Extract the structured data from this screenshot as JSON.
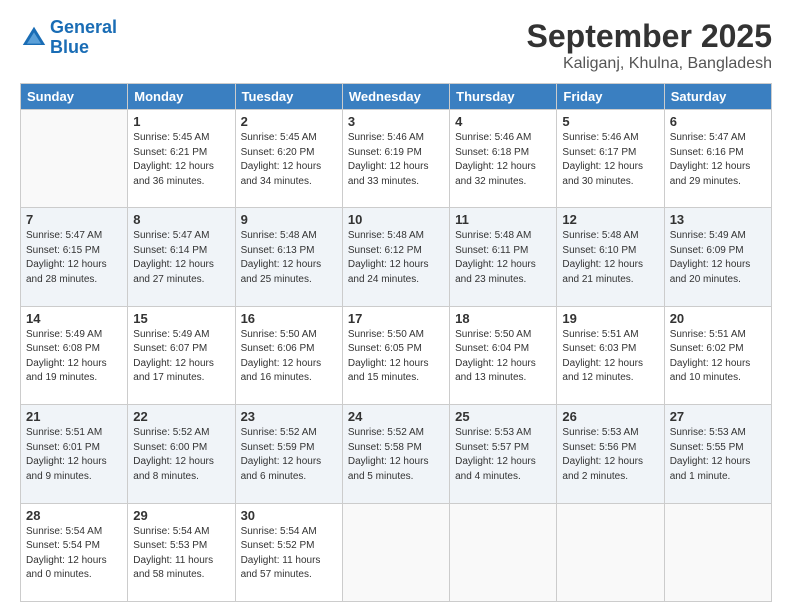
{
  "logo": {
    "line1": "General",
    "line2": "Blue"
  },
  "title": "September 2025",
  "subtitle": "Kaliganj, Khulna, Bangladesh",
  "headers": [
    "Sunday",
    "Monday",
    "Tuesday",
    "Wednesday",
    "Thursday",
    "Friday",
    "Saturday"
  ],
  "weeks": [
    {
      "days": [
        {
          "num": "",
          "info": ""
        },
        {
          "num": "1",
          "info": "Sunrise: 5:45 AM\nSunset: 6:21 PM\nDaylight: 12 hours\nand 36 minutes."
        },
        {
          "num": "2",
          "info": "Sunrise: 5:45 AM\nSunset: 6:20 PM\nDaylight: 12 hours\nand 34 minutes."
        },
        {
          "num": "3",
          "info": "Sunrise: 5:46 AM\nSunset: 6:19 PM\nDaylight: 12 hours\nand 33 minutes."
        },
        {
          "num": "4",
          "info": "Sunrise: 5:46 AM\nSunset: 6:18 PM\nDaylight: 12 hours\nand 32 minutes."
        },
        {
          "num": "5",
          "info": "Sunrise: 5:46 AM\nSunset: 6:17 PM\nDaylight: 12 hours\nand 30 minutes."
        },
        {
          "num": "6",
          "info": "Sunrise: 5:47 AM\nSunset: 6:16 PM\nDaylight: 12 hours\nand 29 minutes."
        }
      ]
    },
    {
      "days": [
        {
          "num": "7",
          "info": "Sunrise: 5:47 AM\nSunset: 6:15 PM\nDaylight: 12 hours\nand 28 minutes."
        },
        {
          "num": "8",
          "info": "Sunrise: 5:47 AM\nSunset: 6:14 PM\nDaylight: 12 hours\nand 27 minutes."
        },
        {
          "num": "9",
          "info": "Sunrise: 5:48 AM\nSunset: 6:13 PM\nDaylight: 12 hours\nand 25 minutes."
        },
        {
          "num": "10",
          "info": "Sunrise: 5:48 AM\nSunset: 6:12 PM\nDaylight: 12 hours\nand 24 minutes."
        },
        {
          "num": "11",
          "info": "Sunrise: 5:48 AM\nSunset: 6:11 PM\nDaylight: 12 hours\nand 23 minutes."
        },
        {
          "num": "12",
          "info": "Sunrise: 5:48 AM\nSunset: 6:10 PM\nDaylight: 12 hours\nand 21 minutes."
        },
        {
          "num": "13",
          "info": "Sunrise: 5:49 AM\nSunset: 6:09 PM\nDaylight: 12 hours\nand 20 minutes."
        }
      ]
    },
    {
      "days": [
        {
          "num": "14",
          "info": "Sunrise: 5:49 AM\nSunset: 6:08 PM\nDaylight: 12 hours\nand 19 minutes."
        },
        {
          "num": "15",
          "info": "Sunrise: 5:49 AM\nSunset: 6:07 PM\nDaylight: 12 hours\nand 17 minutes."
        },
        {
          "num": "16",
          "info": "Sunrise: 5:50 AM\nSunset: 6:06 PM\nDaylight: 12 hours\nand 16 minutes."
        },
        {
          "num": "17",
          "info": "Sunrise: 5:50 AM\nSunset: 6:05 PM\nDaylight: 12 hours\nand 15 minutes."
        },
        {
          "num": "18",
          "info": "Sunrise: 5:50 AM\nSunset: 6:04 PM\nDaylight: 12 hours\nand 13 minutes."
        },
        {
          "num": "19",
          "info": "Sunrise: 5:51 AM\nSunset: 6:03 PM\nDaylight: 12 hours\nand 12 minutes."
        },
        {
          "num": "20",
          "info": "Sunrise: 5:51 AM\nSunset: 6:02 PM\nDaylight: 12 hours\nand 10 minutes."
        }
      ]
    },
    {
      "days": [
        {
          "num": "21",
          "info": "Sunrise: 5:51 AM\nSunset: 6:01 PM\nDaylight: 12 hours\nand 9 minutes."
        },
        {
          "num": "22",
          "info": "Sunrise: 5:52 AM\nSunset: 6:00 PM\nDaylight: 12 hours\nand 8 minutes."
        },
        {
          "num": "23",
          "info": "Sunrise: 5:52 AM\nSunset: 5:59 PM\nDaylight: 12 hours\nand 6 minutes."
        },
        {
          "num": "24",
          "info": "Sunrise: 5:52 AM\nSunset: 5:58 PM\nDaylight: 12 hours\nand 5 minutes."
        },
        {
          "num": "25",
          "info": "Sunrise: 5:53 AM\nSunset: 5:57 PM\nDaylight: 12 hours\nand 4 minutes."
        },
        {
          "num": "26",
          "info": "Sunrise: 5:53 AM\nSunset: 5:56 PM\nDaylight: 12 hours\nand 2 minutes."
        },
        {
          "num": "27",
          "info": "Sunrise: 5:53 AM\nSunset: 5:55 PM\nDaylight: 12 hours\nand 1 minute."
        }
      ]
    },
    {
      "days": [
        {
          "num": "28",
          "info": "Sunrise: 5:54 AM\nSunset: 5:54 PM\nDaylight: 12 hours\nand 0 minutes."
        },
        {
          "num": "29",
          "info": "Sunrise: 5:54 AM\nSunset: 5:53 PM\nDaylight: 11 hours\nand 58 minutes."
        },
        {
          "num": "30",
          "info": "Sunrise: 5:54 AM\nSunset: 5:52 PM\nDaylight: 11 hours\nand 57 minutes."
        },
        {
          "num": "",
          "info": ""
        },
        {
          "num": "",
          "info": ""
        },
        {
          "num": "",
          "info": ""
        },
        {
          "num": "",
          "info": ""
        }
      ]
    }
  ]
}
